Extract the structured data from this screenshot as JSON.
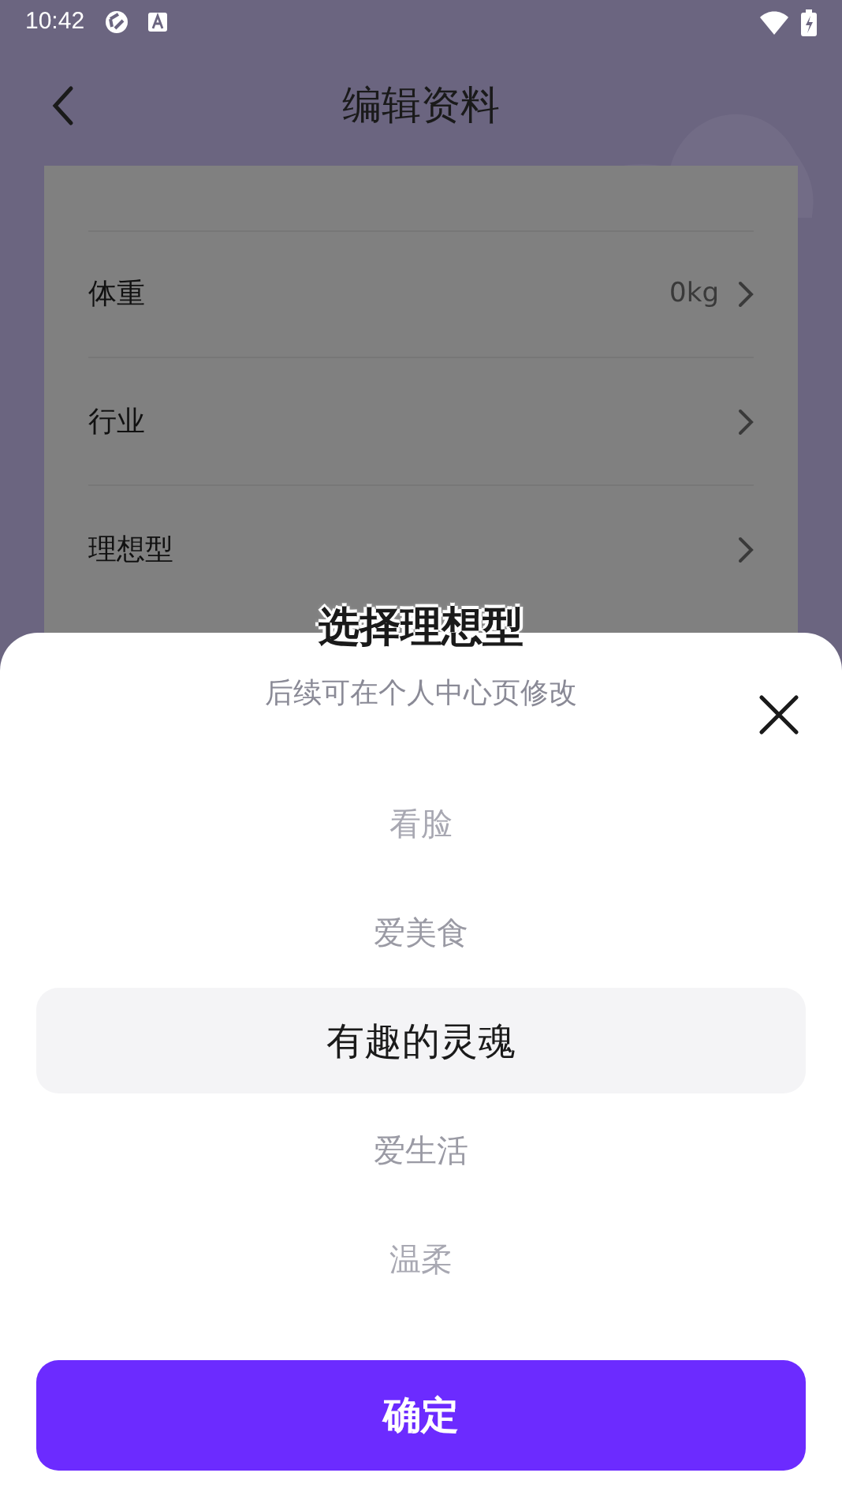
{
  "status_bar": {
    "time": "10:42"
  },
  "header": {
    "title": "编辑资料"
  },
  "profile_rows": [
    {
      "label": "体重",
      "value": "0kg"
    },
    {
      "label": "行业"
    },
    {
      "label": "理想型"
    }
  ],
  "sheet": {
    "title": "选择理想型",
    "subtitle": "后续可在个人中心页修改",
    "options": [
      {
        "label": "看脸",
        "selected": false
      },
      {
        "label": "爱美食",
        "selected": false
      },
      {
        "label": "有趣的灵魂",
        "selected": true
      },
      {
        "label": "爱生活",
        "selected": false
      },
      {
        "label": "温柔",
        "selected": false
      }
    ],
    "confirm": "确定"
  }
}
